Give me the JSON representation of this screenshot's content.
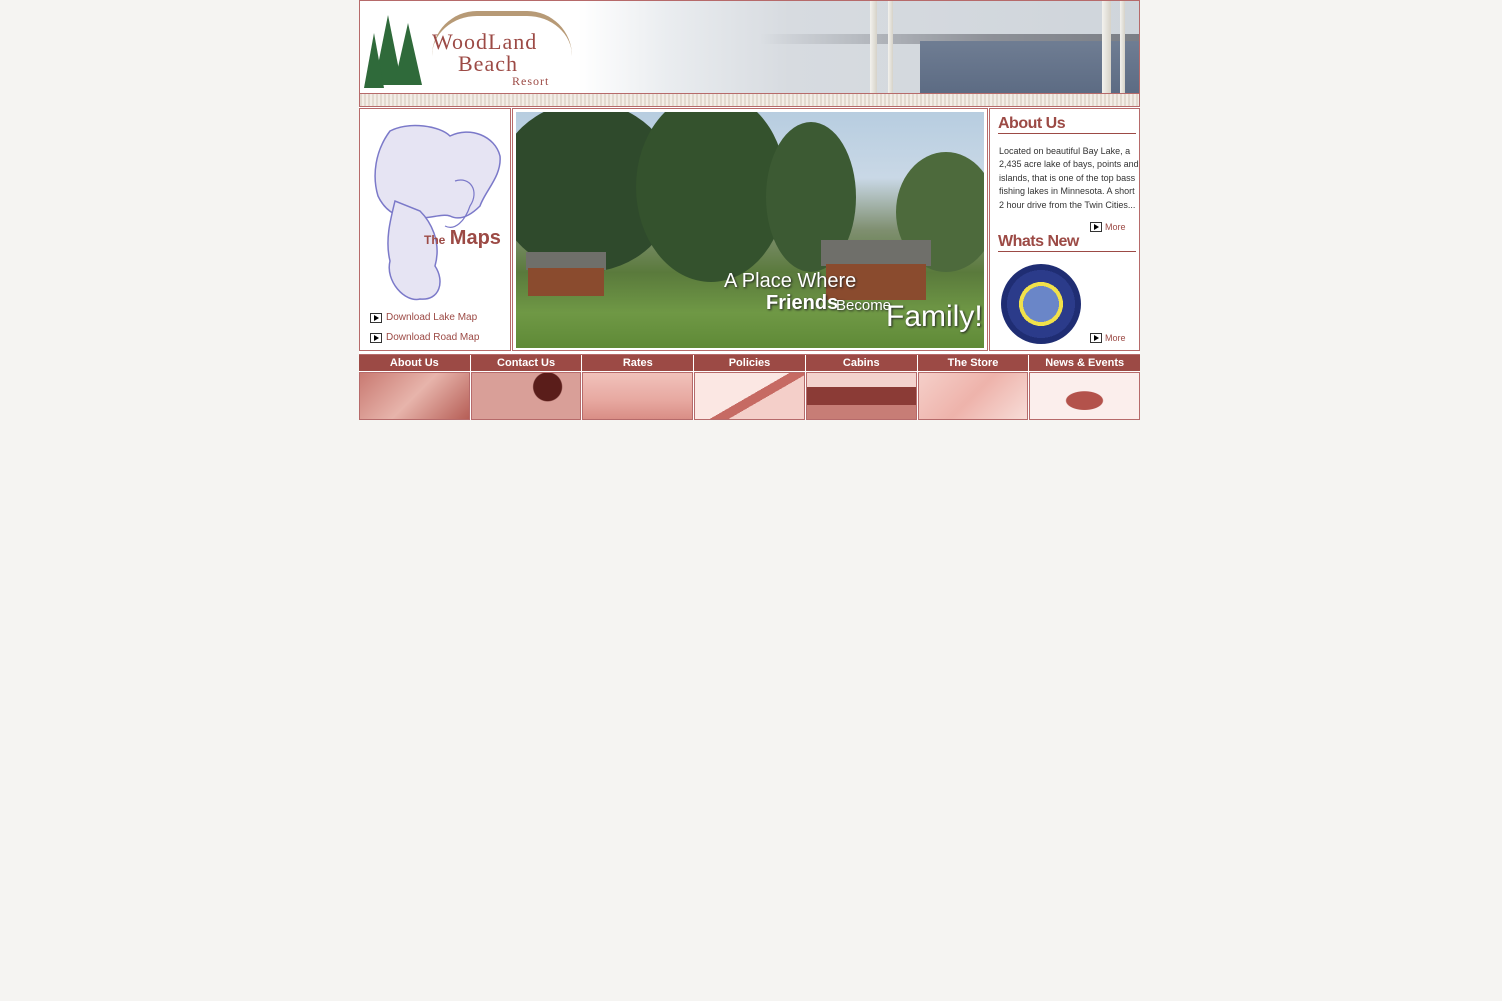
{
  "header": {
    "logo": {
      "line1": "WoodLand",
      "line2": "Beach",
      "line3": "Resort"
    }
  },
  "maps": {
    "title_small": "The",
    "title_big": "Maps",
    "links": [
      "Download Lake Map",
      "Download Road Map"
    ]
  },
  "hero": {
    "line1": "A Place Where",
    "line2a": "Friends",
    "line2b": "Become",
    "line3": "Family!"
  },
  "about": {
    "title": "About Us",
    "text": "Located on beautiful Bay Lake, a 2,435 acre lake of bays, points and islands, that is one of the top bass fishing lakes in Minnesota. A short 2 hour drive from the Twin Cities...",
    "more": "More"
  },
  "whats_new": {
    "title": "Whats New",
    "more": "More"
  },
  "nav": {
    "items": [
      "About Us",
      "Contact Us",
      "Rates",
      "Policies",
      "Cabins",
      "The Store",
      "News & Events"
    ]
  },
  "colors": {
    "brand": "#9c4a45",
    "border": "#b66a6a",
    "page_bg": "#f5f4f2"
  }
}
